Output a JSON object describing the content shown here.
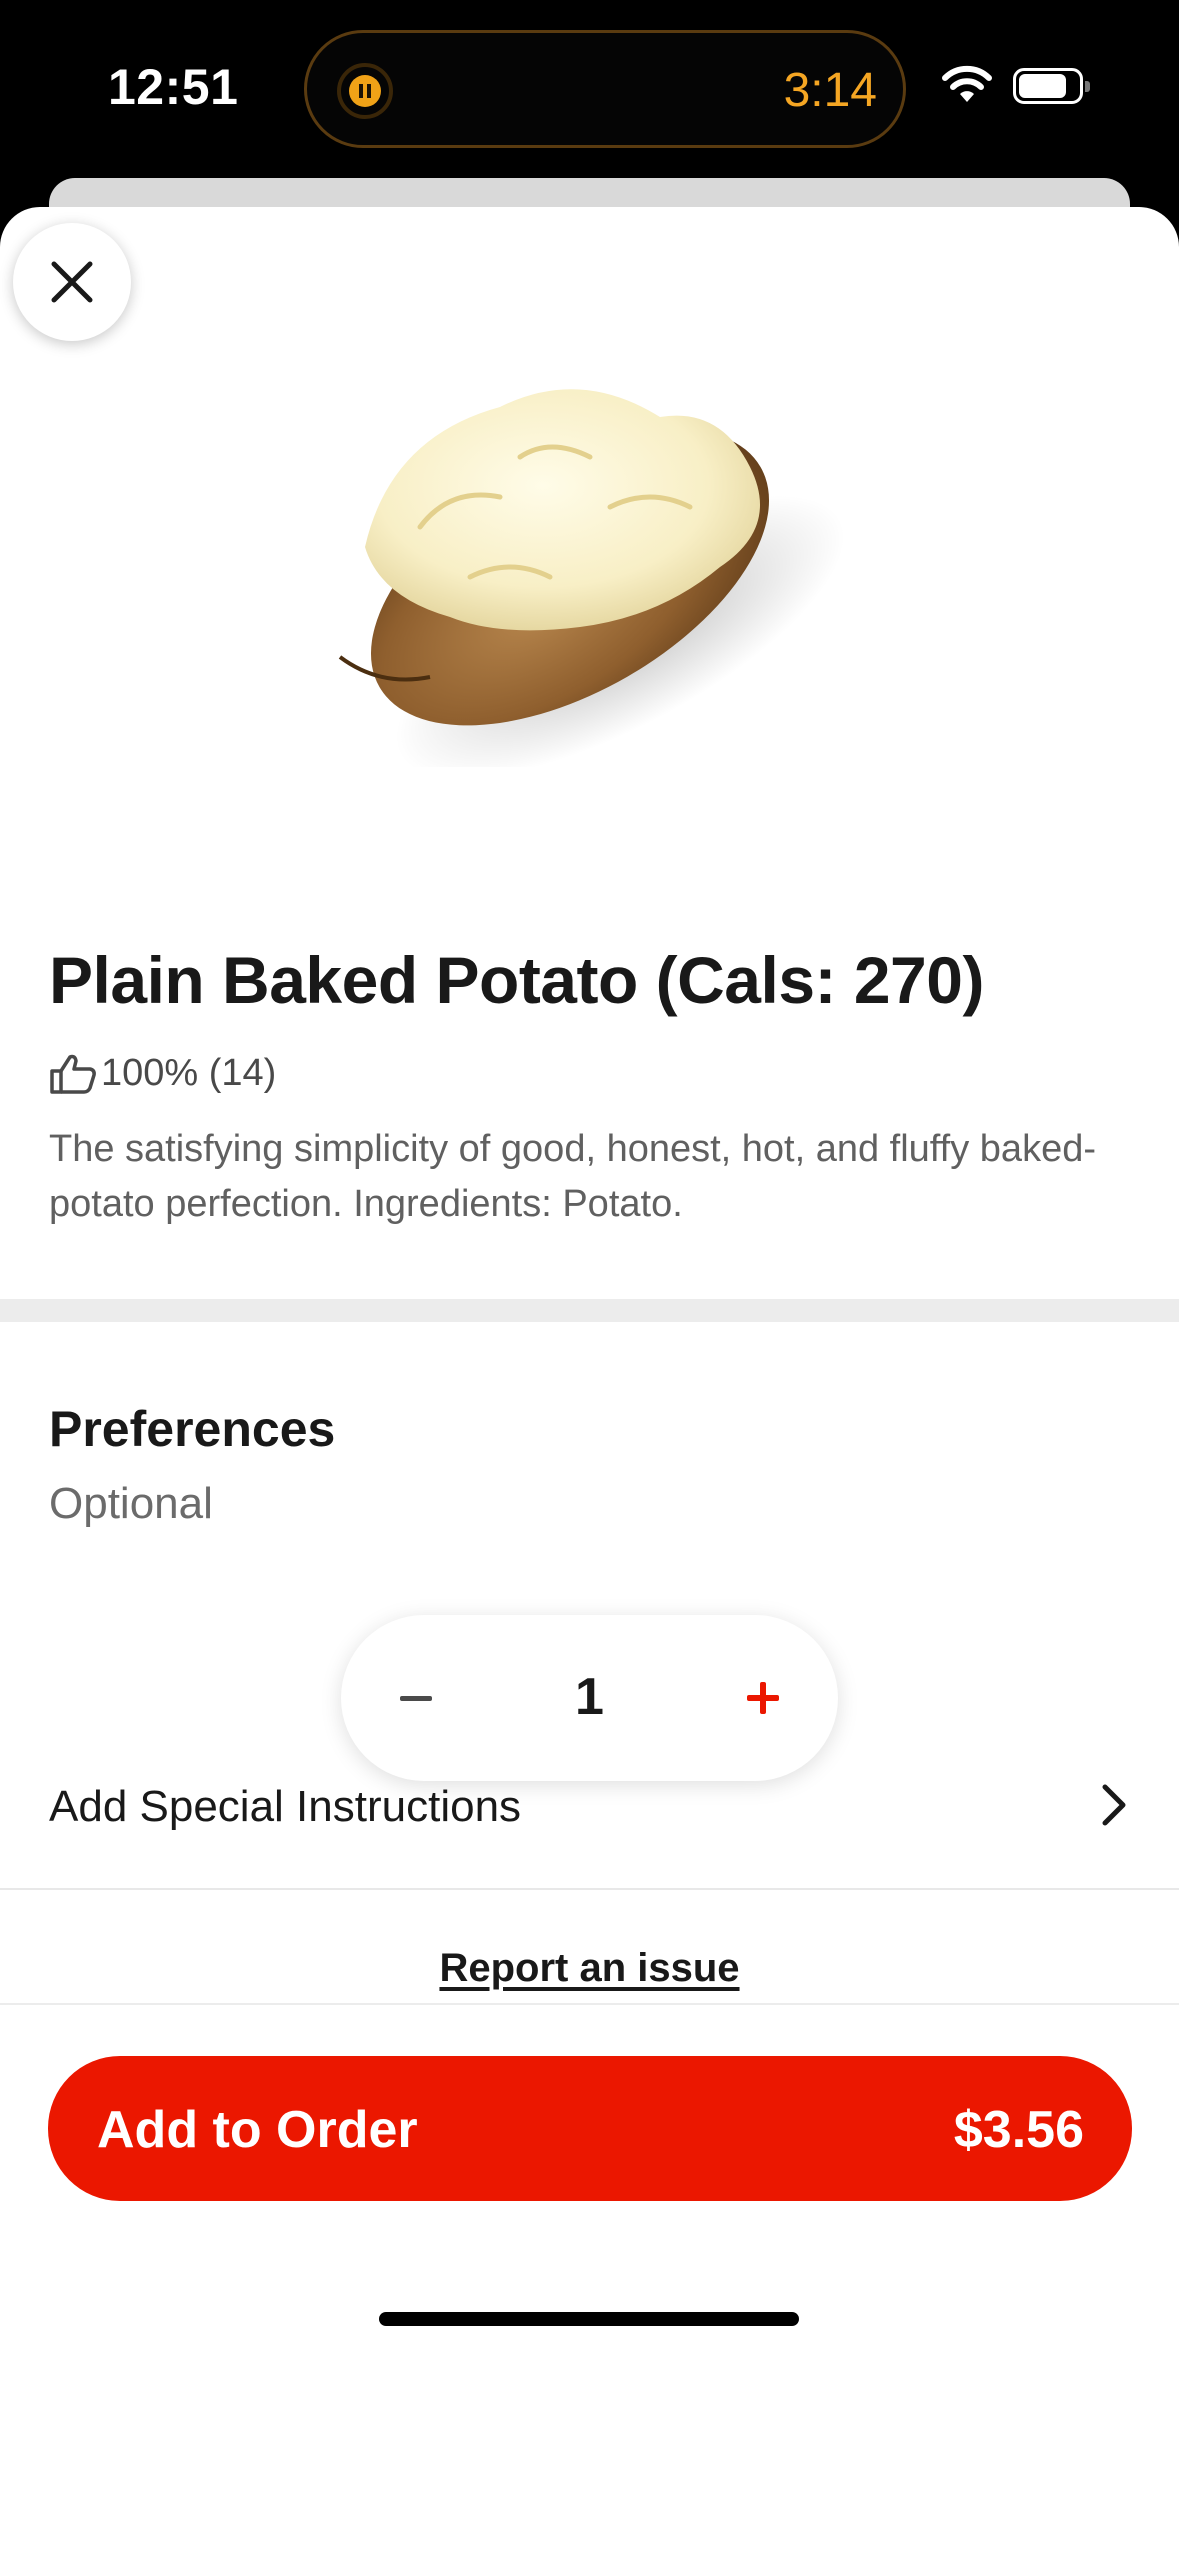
{
  "status_bar": {
    "time": "12:51",
    "timer": "3:14",
    "accent_color": "#f5a623"
  },
  "item": {
    "title": "Plain Baked Potato (Cals: 270)",
    "rating": "100% (14)",
    "rating_icon": "thumbs-up-icon",
    "description": "The satisfying simplicity of good, honest, hot, and fluffy baked-potato perfection. Ingredients: Potato."
  },
  "preferences": {
    "title": "Preferences",
    "subtitle": "Optional",
    "special_instructions_label": "Add Special Instructions"
  },
  "quantity": {
    "value": "1"
  },
  "report_link": "Report an issue",
  "add_button": {
    "label": "Add to Order",
    "price": "$3.56",
    "color": "#eb1700"
  }
}
